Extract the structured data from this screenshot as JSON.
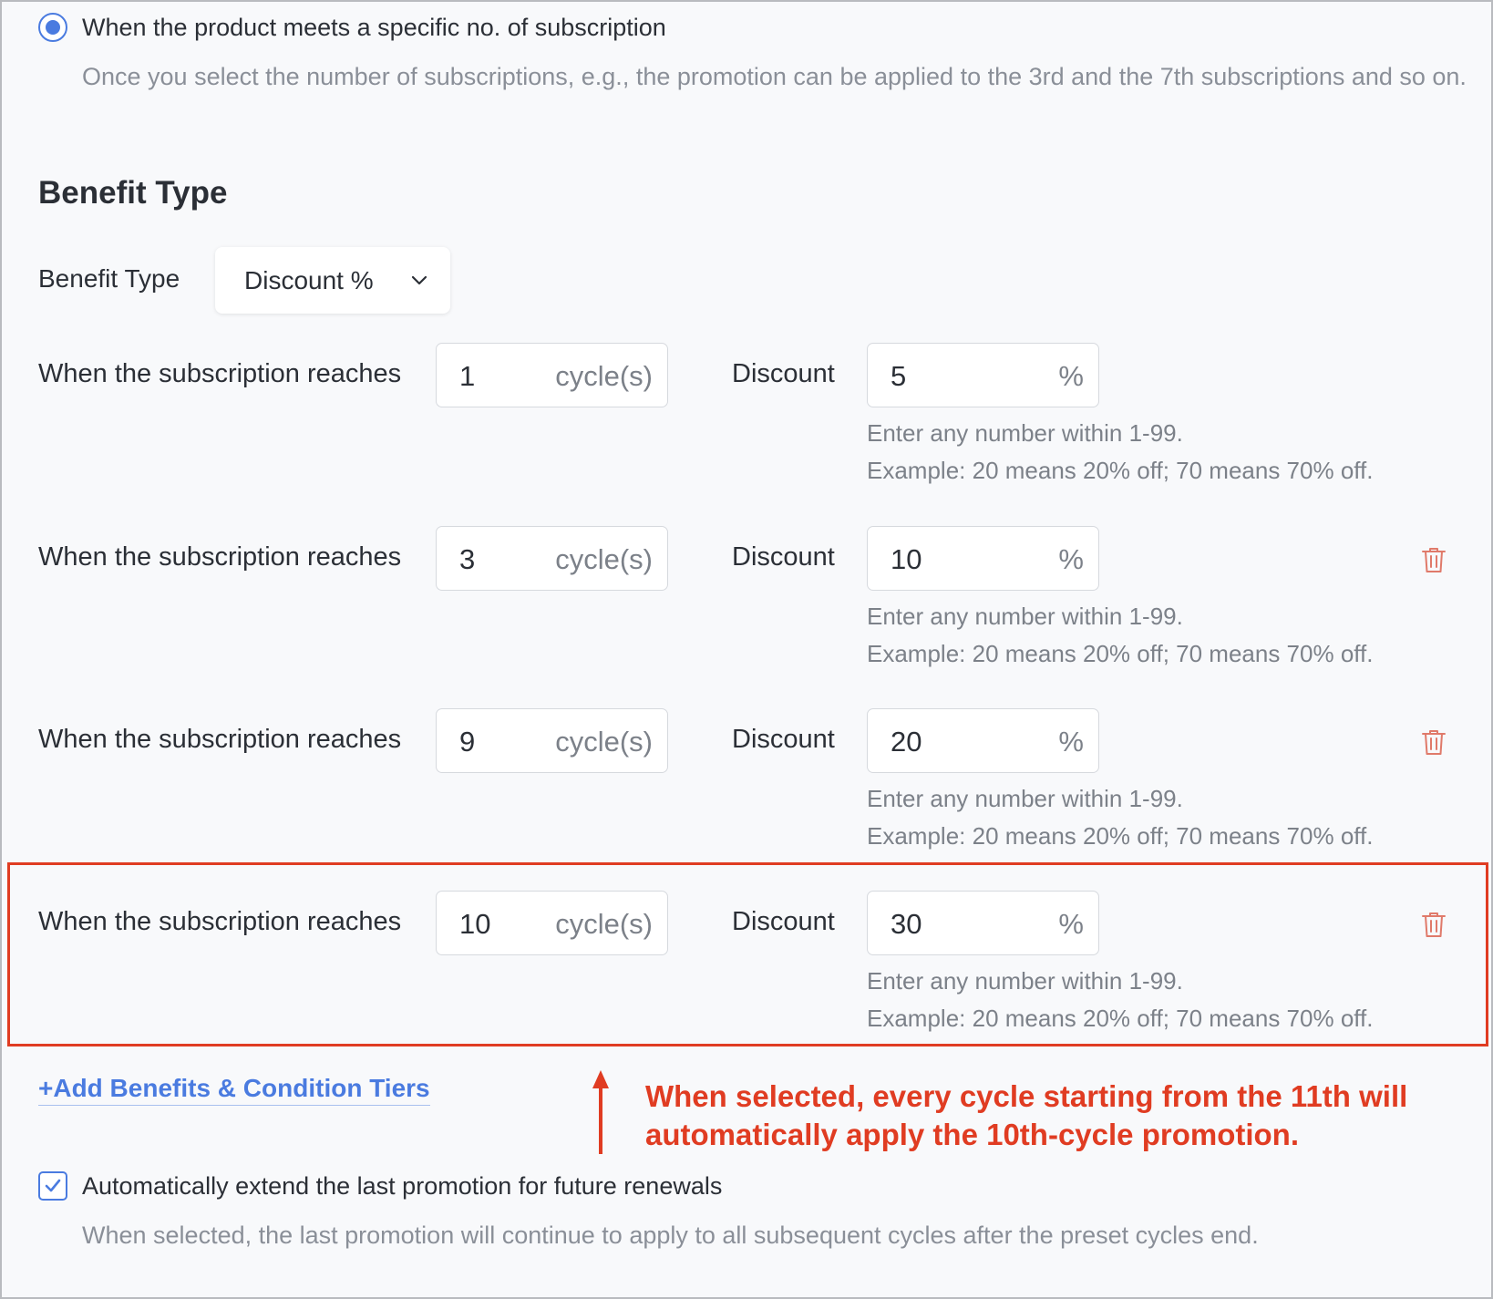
{
  "trigger": {
    "option_label": "When the product meets a specific no. of subscription",
    "option_description": "Once you select the number of subscriptions, e.g., the promotion can be applied to the 3rd and the 7th subscriptions and so on.",
    "selected": true
  },
  "benefit_section": {
    "title": "Benefit Type",
    "field_label": "Benefit Type",
    "selected_value": "Discount %"
  },
  "tiers": [
    {
      "label": "When the subscription reaches",
      "cycles": "1",
      "cycle_unit": "cycle(s)",
      "discount_label": "Discount",
      "discount": "5",
      "discount_unit": "%",
      "hint_line1": "Enter any number within 1-99.",
      "hint_line2": "Example: 20 means 20% off; 70 means 70% off.",
      "deletable": false
    },
    {
      "label": "When the subscription reaches",
      "cycles": "3",
      "cycle_unit": "cycle(s)",
      "discount_label": "Discount",
      "discount": "10",
      "discount_unit": "%",
      "hint_line1": "Enter any number within 1-99.",
      "hint_line2": "Example: 20 means 20% off; 70 means 70% off.",
      "deletable": true
    },
    {
      "label": "When the subscription reaches",
      "cycles": "9",
      "cycle_unit": "cycle(s)",
      "discount_label": "Discount",
      "discount": "20",
      "discount_unit": "%",
      "hint_line1": "Enter any number within 1-99.",
      "hint_line2": "Example: 20 means 20% off; 70 means 70% off.",
      "deletable": true
    },
    {
      "label": "When the subscription reaches",
      "cycles": "10",
      "cycle_unit": "cycle(s)",
      "discount_label": "Discount",
      "discount": "30",
      "discount_unit": "%",
      "hint_line1": "Enter any number within 1-99.",
      "hint_line2": "Example: 20 means 20% off; 70 means 70% off.",
      "deletable": true
    }
  ],
  "add_tier_link": "+Add Benefits & Condition Tiers",
  "annotation": {
    "line1": "When selected, every cycle starting from the 11th will",
    "line2": "automatically apply the 10th-cycle promotion.",
    "color": "#e03c22"
  },
  "extend_option": {
    "label": "Automatically extend the last promotion for future renewals",
    "description": "When selected, the last promotion will continue to apply to all subsequent cycles after the preset cycles end.",
    "checked": true
  },
  "colors": {
    "accent": "#4a7be0",
    "danger_icon": "#e07a6a",
    "annotation": "#e03c22"
  },
  "icons": [
    "chevron-down-icon",
    "trash-icon",
    "checkmark-icon",
    "up-arrow-icon"
  ]
}
